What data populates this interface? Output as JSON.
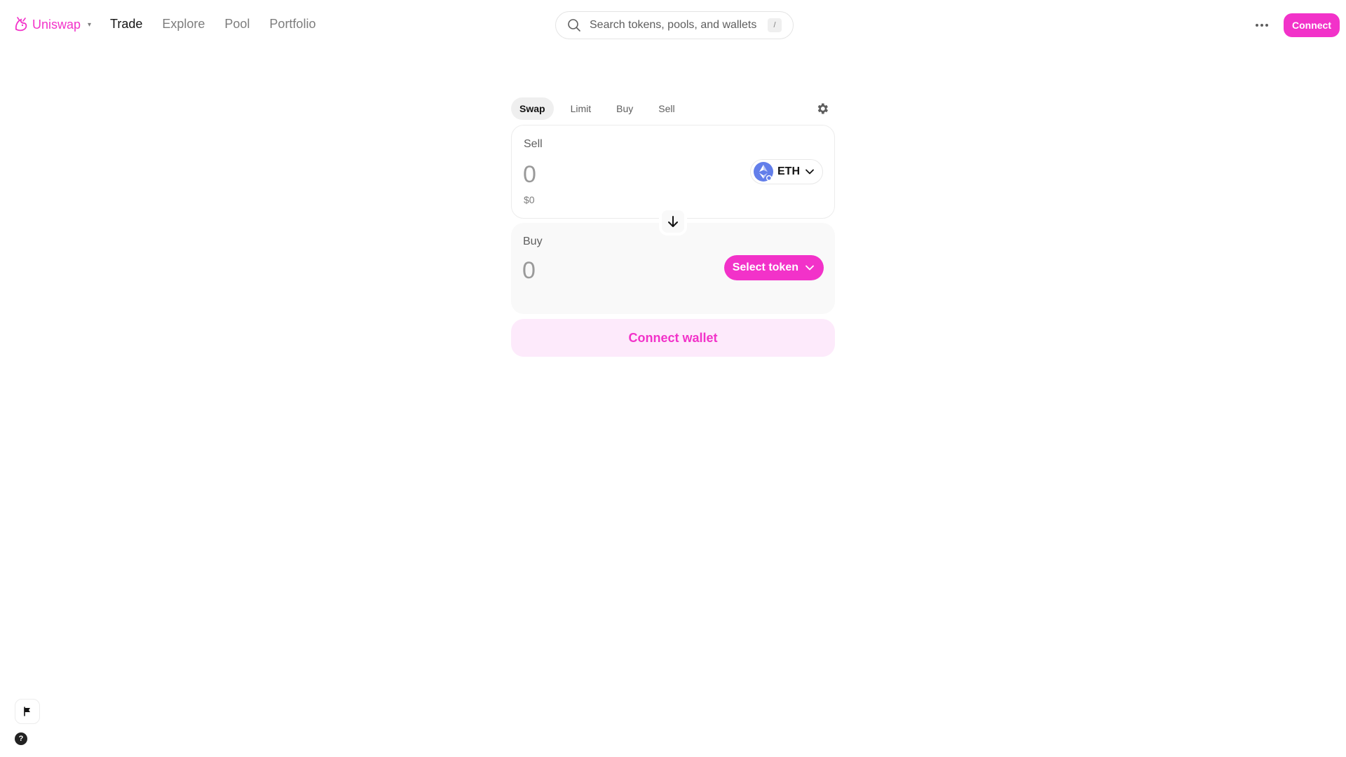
{
  "brand": {
    "name": "Uniswap",
    "logo_icon": "unicorn-logo-icon",
    "caret": "▾",
    "accent_color": "#f232c9"
  },
  "nav": {
    "links": [
      {
        "label": "Trade",
        "active": true
      },
      {
        "label": "Explore",
        "active": false
      },
      {
        "label": "Pool",
        "active": false
      },
      {
        "label": "Portfolio",
        "active": false
      }
    ]
  },
  "search": {
    "placeholder": "Search tokens, pools, and wallets",
    "shortcut": "/"
  },
  "header": {
    "connect_label": "Connect"
  },
  "swap": {
    "tabs": [
      {
        "label": "Swap",
        "active": true
      },
      {
        "label": "Limit",
        "active": false
      },
      {
        "label": "Buy",
        "active": false
      },
      {
        "label": "Sell",
        "active": false
      }
    ],
    "sell": {
      "label": "Sell",
      "amount_placeholder": "0",
      "usd_value": "$0",
      "token_symbol": "ETH"
    },
    "buy": {
      "label": "Buy",
      "amount_placeholder": "0",
      "select_token_label": "Select token"
    },
    "connect_wallet_label": "Connect wallet"
  },
  "footer": {
    "help_glyph": "?"
  }
}
